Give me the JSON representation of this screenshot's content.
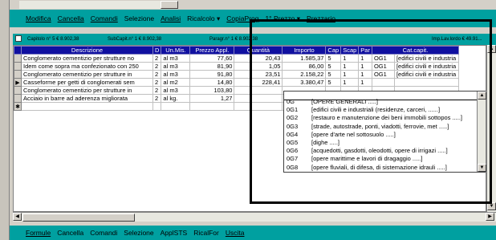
{
  "menubar": {
    "items": [
      {
        "label": "Modifica",
        "key": "M"
      },
      {
        "label": "Cancella",
        "key": "C"
      },
      {
        "label": "Comandi",
        "key": "i"
      },
      {
        "label": "Selezione",
        "key": ""
      },
      {
        "label": "Analisi",
        "key": "A"
      },
      {
        "label": "Ricalcolo ▾",
        "key": ""
      },
      {
        "label": "CopiaProg",
        "key": "C"
      },
      {
        "label": "1° Prezzo ▾",
        "key": ""
      },
      {
        "label": "Prezzario",
        "key": "P"
      }
    ]
  },
  "infobar": {
    "capitolo": "Capitolo n° 5 € 8.902,38",
    "subcapit": "SubCapit.n° 1 € 8.902,38",
    "paragr": "Paragr.n° 1 € 8.902,38",
    "implav": "Imp.Lav.lordo € 49.91..."
  },
  "grid": {
    "headers": [
      "Descrizione",
      "D",
      "Un.Mis.",
      "Prezzo Appl.",
      "Quantità",
      "Importo",
      "Cap",
      "Scap",
      "Par",
      "Cat.capit."
    ],
    "rows": [
      {
        "marker": "",
        "cells": [
          "Conglomerato cementizio per strutture no",
          "2",
          "al m3",
          "77,60",
          "20,43",
          "1.585,37",
          "5",
          "1",
          "1",
          "OG1",
          "[edifici civili e industria"
        ]
      },
      {
        "marker": "",
        "cells": [
          "Idem come sopra ma confezionato con 250",
          "2",
          "al m3",
          "81,90",
          "1,05",
          "86,00",
          "5",
          "1",
          "1",
          "OG1",
          "[edifici civili e industria"
        ]
      },
      {
        "marker": "",
        "cells": [
          "Conglomerato cementizio per strutture in",
          "2",
          "al m3",
          "91,80",
          "23,51",
          "2.158,22",
          "5",
          "1",
          "1",
          "OG1",
          "[edifici civili e industria"
        ]
      },
      {
        "marker": "▶",
        "cells": [
          "Casseforme per getti di conglomerati sem",
          "2",
          "al m2",
          "14,80",
          "228,41",
          "3.380,47",
          "5",
          "1",
          "1",
          "",
          ""
        ]
      },
      {
        "marker": "",
        "cells": [
          "Conglomerato cementizio per strutture in",
          "2",
          "al m3",
          "103,80",
          "",
          "",
          "",
          "",
          "",
          "",
          ""
        ]
      },
      {
        "marker": "",
        "cells": [
          "Acciaio in barre ad aderenza migliorata",
          "2",
          "al kg.",
          "1,27",
          "",
          "",
          "",
          "",
          "",
          "",
          ""
        ]
      },
      {
        "marker": "✱",
        "cells": [
          "",
          "",
          "",
          "",
          "",
          "",
          "",
          "",
          "",
          "",
          ""
        ]
      }
    ]
  },
  "dropdown": {
    "options": [
      {
        "code": "0G",
        "desc": "[OPERE GENERALI .....]"
      },
      {
        "code": "0G1",
        "desc": "[edifici civili e industriali (residenze, carceri, ......]"
      },
      {
        "code": "0G2",
        "desc": "[restauro e manutenzione dei beni immobili sottopos .....]"
      },
      {
        "code": "0G3",
        "desc": "[strade, autostrade, ponti, viadotti, ferrovie, met .....]"
      },
      {
        "code": "0G4",
        "desc": "[opere d'arte nel sottosuolo .....]"
      },
      {
        "code": "0G5",
        "desc": "[dighe .....]"
      },
      {
        "code": "0G6",
        "desc": "[acquedotti, gasdotti, oleodotti, opere di irrigazi .....]"
      },
      {
        "code": "0G7",
        "desc": "[opere marittime e lavori di dragaggio .....]"
      },
      {
        "code": "0G8",
        "desc": "[opere fluviali, di difesa, di sistemazione idrauli .....]"
      }
    ]
  },
  "bottom_menubar": {
    "items": [
      "Formule",
      "Cancella",
      "Comandi",
      "Selezione",
      "ApplSTS",
      "RicalFor",
      "Uscita"
    ]
  },
  "colors": {
    "teal": "#00a0a0",
    "header_blue": "#1010a0"
  }
}
